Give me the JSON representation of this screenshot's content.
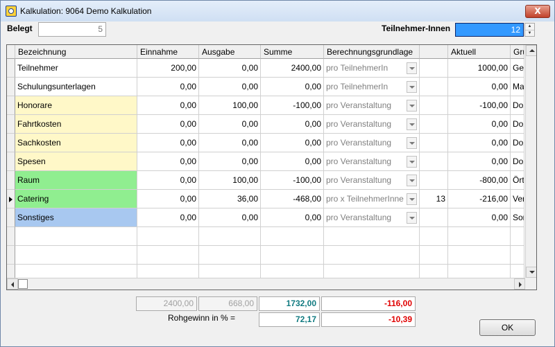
{
  "window": {
    "title": "Kalkulation: 9064 Demo Kalkulation",
    "close_label": "X"
  },
  "header": {
    "belegt_label": "Belegt",
    "belegt_value": "5",
    "teilnehmer_label": "Teilnehmer-Innen",
    "teilnehmer_value": "12"
  },
  "grid": {
    "columns": [
      "Bezeichnung",
      "Einnahme",
      "Ausgabe",
      "Summe",
      "Berechnungsgrundlage",
      "",
      "Aktuell",
      "Gru"
    ],
    "rows": [
      {
        "bez": "Teilnehmer",
        "ein": "200,00",
        "aus": "0,00",
        "sum": "2400,00",
        "ber": "pro TeilnehmerIn",
        "num": "",
        "akt": "1000,00",
        "gru": "Gel"
      },
      {
        "bez": "Schulungsunterlagen",
        "ein": "0,00",
        "aus": "0,00",
        "sum": "0,00",
        "ber": "pro TeilnehmerIn",
        "num": "",
        "akt": "0,00",
        "gru": "Mat"
      },
      {
        "bez": "Honorare",
        "ein": "0,00",
        "aus": "100,00",
        "sum": "-100,00",
        "ber": "pro Veranstaltung",
        "num": "",
        "akt": "-100,00",
        "gru": "Doz"
      },
      {
        "bez": "Fahrtkosten",
        "ein": "0,00",
        "aus": "0,00",
        "sum": "0,00",
        "ber": "pro Veranstaltung",
        "num": "",
        "akt": "0,00",
        "gru": "Doz"
      },
      {
        "bez": "Sachkosten",
        "ein": "0,00",
        "aus": "0,00",
        "sum": "0,00",
        "ber": "pro Veranstaltung",
        "num": "",
        "akt": "0,00",
        "gru": "Doz"
      },
      {
        "bez": "Spesen",
        "ein": "0,00",
        "aus": "0,00",
        "sum": "0,00",
        "ber": "pro Veranstaltung",
        "num": "",
        "akt": "0,00",
        "gru": "Doz"
      },
      {
        "bez": "Raum",
        "ein": "0,00",
        "aus": "100,00",
        "sum": "-100,00",
        "ber": "pro Veranstaltung",
        "num": "",
        "akt": "-800,00",
        "gru": "Örtl"
      },
      {
        "bez": "Catering",
        "ein": "0,00",
        "aus": "36,00",
        "sum": "-468,00",
        "ber": "pro x TeilnehmerInne",
        "num": "13",
        "akt": "-216,00",
        "gru": "Ver"
      },
      {
        "bez": "Sonstiges",
        "ein": "0,00",
        "aus": "0,00",
        "sum": "0,00",
        "ber": "pro Veranstaltung",
        "num": "",
        "akt": "0,00",
        "gru": "Son"
      }
    ],
    "row_colors": {
      "yellow": "#fff8c8",
      "green": "#90ee90",
      "blue": "#a8c8f0"
    }
  },
  "totals": {
    "einnahme": "2400,00",
    "ausgabe": "668,00",
    "summe": "1732,00",
    "aktuell": "-116,00",
    "rohgewinn_label": "Rohgewinn in % =",
    "rohgewinn_summe": "72,17",
    "rohgewinn_aktuell": "-10,39"
  },
  "buttons": {
    "ok": "OK"
  },
  "colors": {
    "teal": "#107a80",
    "red": "#e00000",
    "selection": "#3399ff"
  }
}
